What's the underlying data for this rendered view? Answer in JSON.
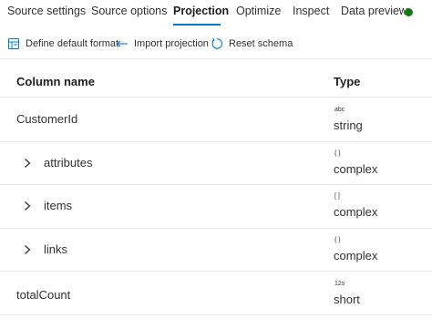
{
  "tabs": [
    {
      "label": "Source settings"
    },
    {
      "label": "Source options"
    },
    {
      "label": "Projection"
    },
    {
      "label": "Optimize"
    },
    {
      "label": "Inspect"
    },
    {
      "label": "Data preview"
    }
  ],
  "active_tab": "Projection",
  "status_color": "#107c10",
  "accent_color": "#0078d4",
  "toolbar": {
    "define_default_format": "Define default format",
    "import_projection": "Import projection",
    "reset_schema": "Reset schema"
  },
  "table": {
    "headers": {
      "column_name": "Column name",
      "type": "Type"
    },
    "rows": [
      {
        "name": "CustomerId",
        "type_icon": "abc",
        "type": "string",
        "expandable": false
      },
      {
        "name": "attributes",
        "type_icon": "{ }",
        "type": "complex",
        "expandable": true
      },
      {
        "name": "items",
        "type_icon": "[ ]",
        "type": "complex",
        "expandable": true
      },
      {
        "name": "links",
        "type_icon": "{ }",
        "type": "complex",
        "expandable": true
      },
      {
        "name": "totalCount",
        "type_icon": "12s",
        "type": "short",
        "expandable": false
      }
    ]
  }
}
